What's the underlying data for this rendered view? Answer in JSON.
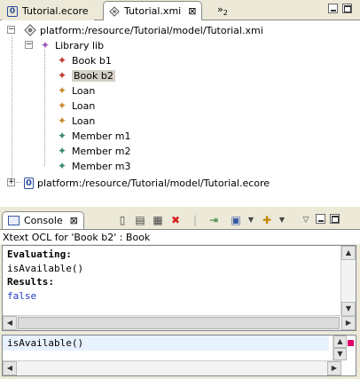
{
  "editor": {
    "tabs": [
      {
        "label": "Tutorial.ecore",
        "active": false
      },
      {
        "label": "Tutorial.xmi",
        "active": true
      }
    ],
    "overflow_label": "»",
    "overflow_count": "2",
    "close_glyph": "⊠",
    "tree": {
      "root1": "platform:/resource/Tutorial/model/Tutorial.xmi",
      "library": "Library lib",
      "items": [
        "Book b1",
        "Book b2",
        "Loan",
        "Loan",
        "Loan",
        "Member m1",
        "Member m2",
        "Member m3"
      ],
      "root2": "platform:/resource/Tutorial/model/Tutorial.ecore",
      "selected_index": 1
    }
  },
  "console": {
    "tab_label": "Console",
    "header": "Xtext OCL for 'Book b2' : Book",
    "output": {
      "evaluating_label": "Evaluating:",
      "expression": "isAvailable()",
      "results_label": "Results:",
      "result": "false"
    },
    "input": "isAvailable()"
  },
  "colors": {
    "chrome": "#ece9d8",
    "selection": "#d4d0c8",
    "input_line": "#e8f2fe",
    "result_blue": "#1f3cc7",
    "marker": "#e0006a"
  }
}
